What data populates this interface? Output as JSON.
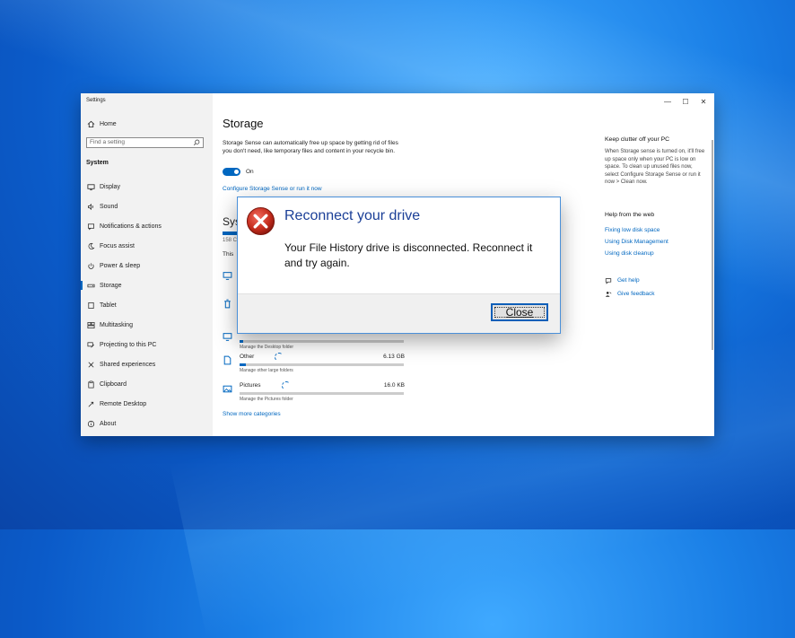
{
  "window": {
    "title": "Settings",
    "controls": [
      "—",
      "☐",
      "✕"
    ]
  },
  "sidebar": {
    "home": "Home",
    "search_placeholder": "Find a setting",
    "section": "System",
    "items": [
      {
        "label": "Display",
        "icon": "display-icon"
      },
      {
        "label": "Sound",
        "icon": "sound-icon"
      },
      {
        "label": "Notifications & actions",
        "icon": "notifications-icon"
      },
      {
        "label": "Focus assist",
        "icon": "focus-assist-icon"
      },
      {
        "label": "Power & sleep",
        "icon": "power-icon"
      },
      {
        "label": "Storage",
        "icon": "storage-icon",
        "active": true
      },
      {
        "label": "Tablet",
        "icon": "tablet-icon"
      },
      {
        "label": "Multitasking",
        "icon": "multitasking-icon"
      },
      {
        "label": "Projecting to this PC",
        "icon": "projecting-icon"
      },
      {
        "label": "Shared experiences",
        "icon": "shared-experiences-icon"
      },
      {
        "label": "Clipboard",
        "icon": "clipboard-icon"
      },
      {
        "label": "Remote Desktop",
        "icon": "remote-desktop-icon"
      },
      {
        "label": "About",
        "icon": "about-icon"
      }
    ]
  },
  "main": {
    "title": "Storage",
    "description": "Storage Sense can automatically free up space by getting rid of files you don't need, like temporary files and content in your recycle bin.",
    "toggle_label": "On",
    "configure_link": "Configure Storage Sense or run it now",
    "partial_heading": "Sys",
    "partial_size": "158 C",
    "partial_this": "This",
    "categories": [
      {
        "name": "",
        "size": "",
        "desc": "Manage the Desktop folder",
        "fill": 0.02,
        "icon": "desktop-icon"
      },
      {
        "name": "Other",
        "size": "6.13 GB",
        "desc": "Manage other large folders",
        "fill": 0.04,
        "icon": "other-files-icon"
      },
      {
        "name": "Pictures",
        "size": "16.0 KB",
        "desc": "Manage the Pictures folder",
        "fill": 0.0,
        "icon": "pictures-icon"
      }
    ],
    "show_more": "Show more categories"
  },
  "right_panel": {
    "clutter_heading": "Keep clutter off your PC",
    "clutter_text": "When Storage sense is turned on, it'll free up space only when your PC is low on space. To clean up unused files now, select Configure Storage Sense or run it now > Clean now.",
    "help_heading": "Help from the web",
    "help_links": [
      "Fixing low disk space",
      "Using Disk Management",
      "Using disk cleanup"
    ],
    "get_help": "Get help",
    "give_feedback": "Give feedback"
  },
  "dialog": {
    "title": "Reconnect your drive",
    "message": "Your File History drive is disconnected. Reconnect it and try again.",
    "button": "Close",
    "accent": "#1b3f97"
  },
  "colors": {
    "accent": "#0067c0",
    "error": "#c42b1c"
  }
}
